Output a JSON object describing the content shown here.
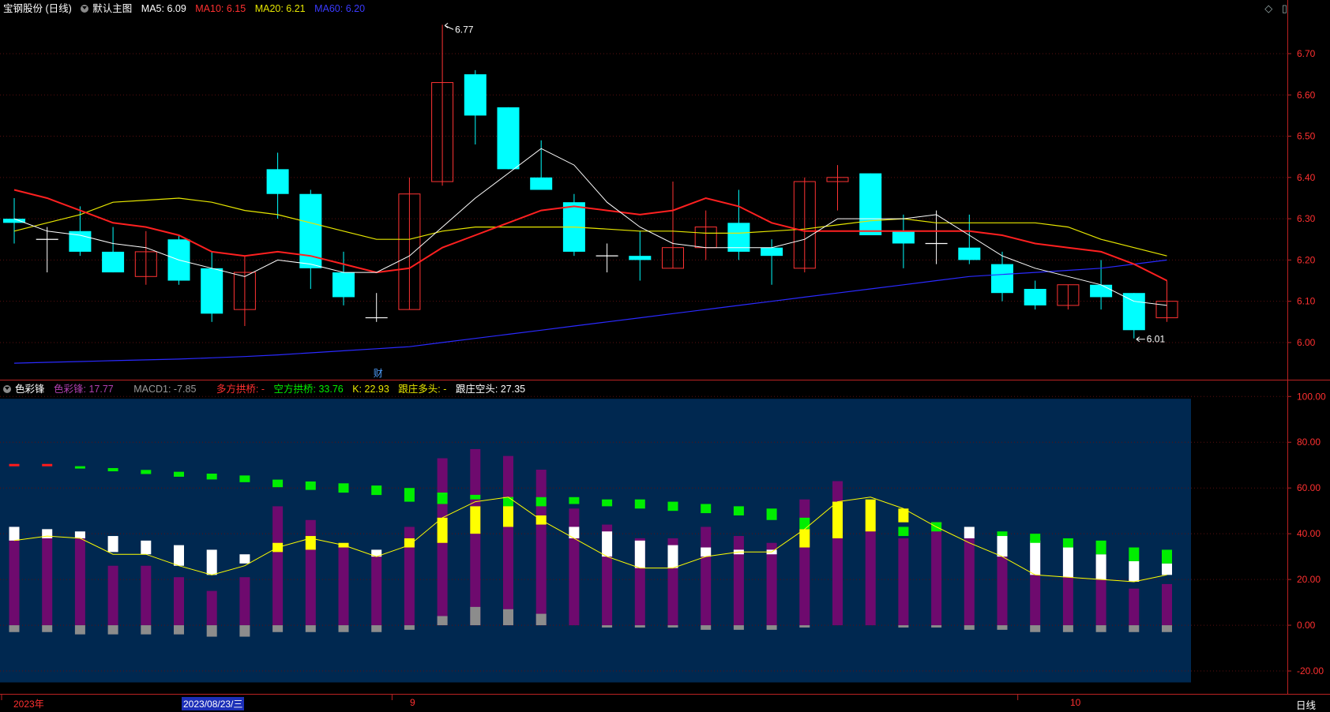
{
  "stock": {
    "title": "宝钢股份 (日线)",
    "template": "默认主图",
    "ma5_label": "MA5: 6.09",
    "ma10_label": "MA10: 6.15",
    "ma20_label": "MA20: 6.21",
    "ma60_label": "MA60: 6.20",
    "high_label": "6.77",
    "low_label": "6.01",
    "finance_marker": "财"
  },
  "indicator": {
    "name": "色彩锋",
    "value_label": "色彩锋: 17.77",
    "macd_label": "MACD1: -7.85",
    "long_bridge_label": "多方拱桥: -",
    "short_bridge_label": "空方拱桥: 33.76",
    "k_label": "K: 22.93",
    "follow_long_label": "跟庄多头: -",
    "follow_short_label": "跟庄空头: 27.35"
  },
  "top_icons": [
    "◇",
    "▯"
  ],
  "x_axis": {
    "year": "2023年",
    "cursor_date": "2023/08/23/三",
    "month9": "9",
    "month10": "10",
    "period": "日线"
  },
  "colors": {
    "up": "#ff3333",
    "down": "#00ffff",
    "ma5": "#ffffff",
    "ma10": "#ff2020",
    "ma20": "#e6e600",
    "ma60": "#2a2aff",
    "purple": "#6e0a6e",
    "white_bar": "#ffffff",
    "yellow": "#ffff00",
    "green": "#00ee00",
    "gray": "#8c8c8c",
    "panel_bg": "#002850"
  },
  "chart_data": [
    {
      "type": "candlestick",
      "y_ticks": [
        "6.70",
        "6.60",
        "6.50",
        "6.40",
        "6.30",
        "6.20",
        "6.10",
        "6.00"
      ],
      "ylim": [
        5.91,
        6.83
      ],
      "candles": [
        {
          "o": 6.3,
          "h": 6.35,
          "l": 6.24,
          "c": 6.29
        },
        {
          "o": 6.25,
          "h": 6.28,
          "l": 6.17,
          "c": 6.25
        },
        {
          "o": 6.27,
          "h": 6.33,
          "l": 6.21,
          "c": 6.22
        },
        {
          "o": 6.22,
          "h": 6.28,
          "l": 6.17,
          "c": 6.17
        },
        {
          "o": 6.16,
          "h": 6.27,
          "l": 6.14,
          "c": 6.22
        },
        {
          "o": 6.25,
          "h": 6.26,
          "l": 6.14,
          "c": 6.15
        },
        {
          "o": 6.18,
          "h": 6.22,
          "l": 6.05,
          "c": 6.07
        },
        {
          "o": 6.08,
          "h": 6.21,
          "l": 6.04,
          "c": 6.17
        },
        {
          "o": 6.42,
          "h": 6.46,
          "l": 6.3,
          "c": 6.36
        },
        {
          "o": 6.36,
          "h": 6.37,
          "l": 6.13,
          "c": 6.18
        },
        {
          "o": 6.17,
          "h": 6.22,
          "l": 6.09,
          "c": 6.11
        },
        {
          "o": 6.06,
          "h": 6.12,
          "l": 6.05,
          "c": 6.06
        },
        {
          "o": 6.08,
          "h": 6.4,
          "l": 6.08,
          "c": 6.36
        },
        {
          "o": 6.39,
          "h": 6.77,
          "l": 6.38,
          "c": 6.63
        },
        {
          "o": 6.65,
          "h": 6.66,
          "l": 6.48,
          "c": 6.55
        },
        {
          "o": 6.57,
          "h": 6.57,
          "l": 6.42,
          "c": 6.42
        },
        {
          "o": 6.4,
          "h": 6.49,
          "l": 6.37,
          "c": 6.37
        },
        {
          "o": 6.34,
          "h": 6.36,
          "l": 6.21,
          "c": 6.22
        },
        {
          "o": 6.21,
          "h": 6.24,
          "l": 6.17,
          "c": 6.21
        },
        {
          "o": 6.21,
          "h": 6.27,
          "l": 6.15,
          "c": 6.2
        },
        {
          "o": 6.18,
          "h": 6.39,
          "l": 6.18,
          "c": 6.23
        },
        {
          "o": 6.23,
          "h": 6.32,
          "l": 6.2,
          "c": 6.28
        },
        {
          "o": 6.29,
          "h": 6.37,
          "l": 6.2,
          "c": 6.22
        },
        {
          "o": 6.23,
          "h": 6.25,
          "l": 6.14,
          "c": 6.21
        },
        {
          "o": 6.18,
          "h": 6.4,
          "l": 6.17,
          "c": 6.39
        },
        {
          "o": 6.39,
          "h": 6.43,
          "l": 6.32,
          "c": 6.4
        },
        {
          "o": 6.41,
          "h": 6.41,
          "l": 6.26,
          "c": 6.26
        },
        {
          "o": 6.27,
          "h": 6.31,
          "l": 6.18,
          "c": 6.24
        },
        {
          "o": 6.24,
          "h": 6.32,
          "l": 6.19,
          "c": 6.24
        },
        {
          "o": 6.23,
          "h": 6.31,
          "l": 6.19,
          "c": 6.2
        },
        {
          "o": 6.19,
          "h": 6.22,
          "l": 6.1,
          "c": 6.12
        },
        {
          "o": 6.13,
          "h": 6.15,
          "l": 6.08,
          "c": 6.09
        },
        {
          "o": 6.09,
          "h": 6.14,
          "l": 6.08,
          "c": 6.14
        },
        {
          "o": 6.14,
          "h": 6.2,
          "l": 6.08,
          "c": 6.11
        },
        {
          "o": 6.12,
          "h": 6.12,
          "l": 6.01,
          "c": 6.03
        },
        {
          "o": 6.06,
          "h": 6.15,
          "l": 6.05,
          "c": 6.1
        }
      ],
      "ma5": [
        6.3,
        6.27,
        6.26,
        6.24,
        6.23,
        6.2,
        6.18,
        6.16,
        6.2,
        6.19,
        6.17,
        6.17,
        6.21,
        6.28,
        6.35,
        6.41,
        6.47,
        6.43,
        6.34,
        6.28,
        6.24,
        6.23,
        6.23,
        6.23,
        6.25,
        6.3,
        6.3,
        6.3,
        6.31,
        6.26,
        6.21,
        6.18,
        6.16,
        6.14,
        6.1,
        6.09
      ],
      "ma10": [
        6.37,
        6.35,
        6.32,
        6.29,
        6.28,
        6.26,
        6.22,
        6.21,
        6.22,
        6.21,
        6.19,
        6.17,
        6.18,
        6.23,
        6.26,
        6.29,
        6.32,
        6.33,
        6.32,
        6.31,
        6.32,
        6.35,
        6.33,
        6.29,
        6.27,
        6.27,
        6.27,
        6.27,
        6.27,
        6.27,
        6.26,
        6.24,
        6.23,
        6.22,
        6.19,
        6.15
      ],
      "ma20": [
        6.27,
        6.29,
        6.31,
        6.34,
        6.345,
        6.35,
        6.34,
        6.32,
        6.31,
        6.29,
        6.27,
        6.25,
        6.25,
        6.27,
        6.28,
        6.28,
        6.28,
        6.28,
        6.275,
        6.27,
        6.27,
        6.265,
        6.265,
        6.27,
        6.275,
        6.285,
        6.295,
        6.3,
        6.29,
        6.29,
        6.29,
        6.29,
        6.28,
        6.25,
        6.23,
        6.21
      ],
      "ma60": [
        5.95,
        5.952,
        5.954,
        5.956,
        5.958,
        5.96,
        5.963,
        5.966,
        5.97,
        5.975,
        5.98,
        5.985,
        5.99,
        6.0,
        6.01,
        6.02,
        6.03,
        6.04,
        6.05,
        6.06,
        6.07,
        6.08,
        6.09,
        6.1,
        6.11,
        6.12,
        6.13,
        6.14,
        6.15,
        6.16,
        6.165,
        6.17,
        6.175,
        6.18,
        6.19,
        6.2
      ]
    },
    {
      "type": "bar",
      "y_ticks": [
        "100.00",
        "80.00",
        "60.00",
        "40.00",
        "20.00",
        "0.00",
        "-20.00"
      ],
      "ylim": [
        -30,
        107
      ],
      "purple": [
        43,
        41,
        38,
        26,
        26,
        21,
        15,
        21,
        52,
        46,
        35,
        31,
        43,
        73,
        77,
        74,
        68,
        51,
        44,
        38,
        38,
        43,
        39,
        36,
        55,
        63,
        42,
        38,
        45,
        41,
        40,
        39,
        35,
        29,
        16,
        18
      ],
      "white": [
        [
          37,
          43
        ],
        [
          38,
          42
        ],
        [
          38,
          41
        ],
        [
          32,
          39
        ],
        [
          31,
          37
        ],
        [
          26,
          35
        ],
        [
          22,
          33
        ],
        [
          27,
          31
        ],
        [
          0,
          0
        ],
        [
          0,
          0
        ],
        [
          0,
          0
        ],
        [
          30,
          33
        ],
        [
          0,
          0
        ],
        [
          0,
          0
        ],
        [
          0,
          0
        ],
        [
          0,
          0
        ],
        [
          0,
          0
        ],
        [
          38,
          43
        ],
        [
          30,
          41
        ],
        [
          25,
          37
        ],
        [
          25,
          35
        ],
        [
          30,
          34
        ],
        [
          31,
          33
        ],
        [
          31,
          33
        ],
        [
          0,
          0
        ],
        [
          0,
          0
        ],
        [
          0,
          0
        ],
        [
          0,
          0
        ],
        [
          0,
          0
        ],
        [
          38,
          43
        ],
        [
          30,
          40
        ],
        [
          22,
          37
        ],
        [
          21,
          34
        ],
        [
          20,
          31
        ],
        [
          19,
          28
        ],
        [
          22,
          27
        ]
      ],
      "yellow": [
        [
          0,
          0
        ],
        [
          0,
          0
        ],
        [
          0,
          0
        ],
        [
          0,
          0
        ],
        [
          0,
          0
        ],
        [
          0,
          0
        ],
        [
          0,
          0
        ],
        [
          0,
          0
        ],
        [
          32,
          36
        ],
        [
          33,
          39
        ],
        [
          34,
          36
        ],
        [
          0,
          0
        ],
        [
          34,
          38
        ],
        [
          36,
          47
        ],
        [
          40,
          52
        ],
        [
          43,
          56
        ],
        [
          44,
          48
        ],
        [
          0,
          0
        ],
        [
          0,
          0
        ],
        [
          0,
          0
        ],
        [
          0,
          0
        ],
        [
          0,
          0
        ],
        [
          0,
          0
        ],
        [
          0,
          0
        ],
        [
          34,
          42
        ],
        [
          38,
          54
        ],
        [
          41,
          55
        ],
        [
          45,
          51
        ],
        [
          44,
          45
        ],
        [
          0,
          0
        ],
        [
          0,
          0
        ],
        [
          0,
          0
        ],
        [
          0,
          0
        ],
        [
          0,
          0
        ],
        [
          0,
          0
        ],
        [
          0,
          0
        ]
      ],
      "green": [
        [
          0,
          0
        ],
        [
          0,
          0
        ],
        [
          0,
          0
        ],
        [
          0,
          0
        ],
        [
          0,
          0
        ],
        [
          0,
          0
        ],
        [
          0,
          0
        ],
        [
          0,
          0
        ],
        [
          0,
          0
        ],
        [
          0,
          0
        ],
        [
          0,
          0
        ],
        [
          0,
          0
        ],
        [
          54,
          60
        ],
        [
          53,
          58
        ],
        [
          55,
          57
        ],
        [
          52,
          56
        ],
        [
          52,
          56
        ],
        [
          53,
          56
        ],
        [
          52,
          55
        ],
        [
          51,
          55
        ],
        [
          50,
          54
        ],
        [
          49,
          53
        ],
        [
          48,
          52
        ],
        [
          46,
          51
        ],
        [
          42,
          47
        ],
        [
          0,
          0
        ],
        [
          0,
          0
        ],
        [
          39,
          43
        ],
        [
          41,
          45
        ],
        [
          0,
          0
        ],
        [
          39,
          41
        ],
        [
          36,
          40
        ],
        [
          34,
          38
        ],
        [
          31,
          37
        ],
        [
          28,
          34
        ],
        [
          27,
          33
        ]
      ],
      "dash": [
        {
          "v": 70,
          "c": "red"
        },
        {
          "v": 70,
          "c": "red"
        },
        {
          "v": 69,
          "c": "green"
        },
        {
          "v": 68,
          "c": "green"
        },
        {
          "v": 67,
          "c": "green"
        },
        {
          "v": 66,
          "c": "green"
        },
        {
          "v": 65,
          "c": "green"
        },
        {
          "v": 64,
          "c": "green"
        },
        {
          "v": 62,
          "c": "green"
        },
        {
          "v": 61,
          "c": "green"
        },
        {
          "v": 60,
          "c": "green"
        },
        {
          "v": 59,
          "c": "green"
        }
      ],
      "gray": [
        -3,
        -3,
        -4,
        -4,
        -4,
        -4,
        -5,
        -5,
        -3,
        -3,
        -3,
        -3,
        -2,
        4,
        8,
        7,
        5,
        0,
        -1,
        -1,
        -1,
        -2,
        -2,
        -2,
        -1,
        0,
        0,
        -1,
        -1,
        -2,
        -2,
        -3,
        -3,
        -3,
        -3,
        -3
      ],
      "k_line": [
        37,
        39,
        38,
        31,
        31,
        26,
        22,
        26,
        34,
        38,
        35,
        30,
        35,
        47,
        54,
        56,
        46,
        38,
        30,
        25,
        25,
        30,
        32,
        32,
        42,
        54,
        56,
        51,
        43,
        36,
        30,
        22,
        21,
        20,
        19,
        22
      ]
    }
  ]
}
